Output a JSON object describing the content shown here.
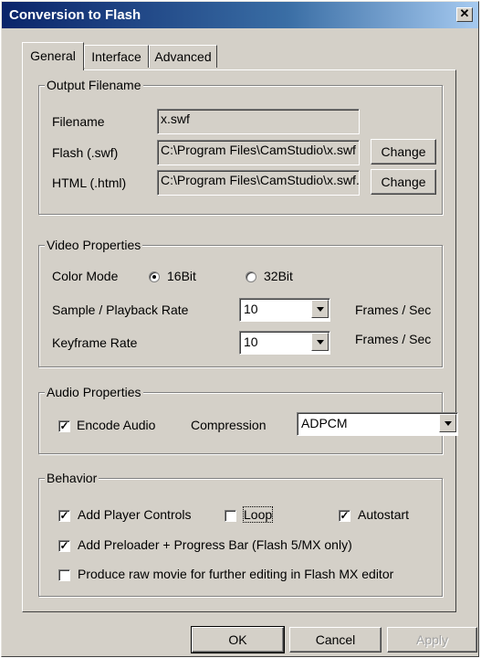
{
  "window": {
    "title": "Conversion to Flash",
    "close_glyph": "✕"
  },
  "tabs": [
    {
      "label": "General",
      "active": true
    },
    {
      "label": "Interface",
      "active": false
    },
    {
      "label": "Advanced",
      "active": false
    }
  ],
  "output_filename": {
    "legend": "Output Filename",
    "filename_label": "Filename",
    "filename_value": "x.swf",
    "flash_label": "Flash (.swf)",
    "flash_value": "C:\\Program Files\\CamStudio\\x.swf",
    "flash_change": "Change",
    "html_label": "HTML (.html)",
    "html_value": "C:\\Program Files\\CamStudio\\x.swf.",
    "html_change": "Change"
  },
  "video": {
    "legend": "Video Properties",
    "color_mode_label": "Color Mode",
    "option_16": "16Bit",
    "option_32": "32Bit",
    "selected": "16Bit",
    "sample_label": "Sample / Playback  Rate",
    "sample_value": "10",
    "sample_unit": "Frames / Sec",
    "keyframe_label": "Keyframe  Rate",
    "keyframe_value": "10",
    "keyframe_unit": "Frames / Sec"
  },
  "audio": {
    "legend": "Audio Properties",
    "encode_label": "Encode Audio",
    "encode_checked": true,
    "compression_label": "Compression",
    "compression_value": "ADPCM"
  },
  "behavior": {
    "legend": "Behavior",
    "player_controls": "Add Player Controls",
    "player_controls_checked": true,
    "loop": "Loop",
    "loop_checked": false,
    "autostart": "Autostart",
    "autostart_checked": true,
    "preloader": "Add Preloader + Progress Bar  (Flash 5/MX only)",
    "preloader_checked": true,
    "raw_movie": "Produce raw movie for further editing in Flash MX editor",
    "raw_movie_checked": false
  },
  "footer": {
    "ok": "OK",
    "cancel": "Cancel",
    "apply": "Apply"
  },
  "check_glyph": "✓"
}
